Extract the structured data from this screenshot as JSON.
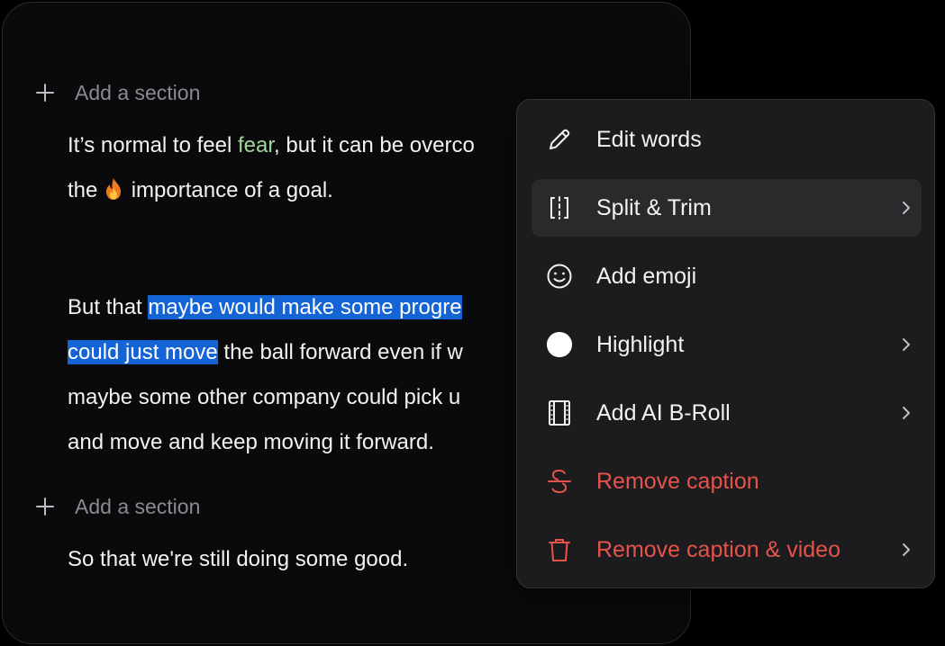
{
  "editor": {
    "add_section_label": "Add a section",
    "paragraph1": {
      "part1": "It’s normal to feel ",
      "highlight_word": "fear",
      "part2": ", but it can be overco",
      "line2_a": "the ",
      "emoji": "fire",
      "line2_b": " importance of a goal."
    },
    "paragraph2": {
      "line1_plain": "But that ",
      "line1_selected": "maybe would make some progre",
      "line2_selected": "could just move",
      "line2_plain": " the ball forward even if w",
      "line3": "maybe some other company could pick u",
      "line4": "and move and keep moving it forward."
    },
    "paragraph3": {
      "line1": "So that we're still doing some good."
    }
  },
  "menu": {
    "items": [
      {
        "label": "Edit words",
        "icon": "pencil-icon",
        "submenu": false
      },
      {
        "label": "Split & Trim",
        "icon": "split-trim-icon",
        "submenu": true
      },
      {
        "label": "Add emoji",
        "icon": "smiley-icon",
        "submenu": false
      },
      {
        "label": "Highlight",
        "icon": "white-circle-icon",
        "submenu": true
      },
      {
        "label": "Add AI B-Roll",
        "icon": "film-strip-icon",
        "submenu": true
      },
      {
        "label": "Remove caption",
        "icon": "strikethrough-icon",
        "submenu": false
      },
      {
        "label": "Remove caption & video",
        "icon": "trash-icon",
        "submenu": true
      }
    ]
  },
  "colors": {
    "background": "#0a0a0c",
    "selection": "#1464d6",
    "green_word": "#9fd79a",
    "danger": "#e5534b",
    "menu_bg": "#1c1c1e"
  }
}
